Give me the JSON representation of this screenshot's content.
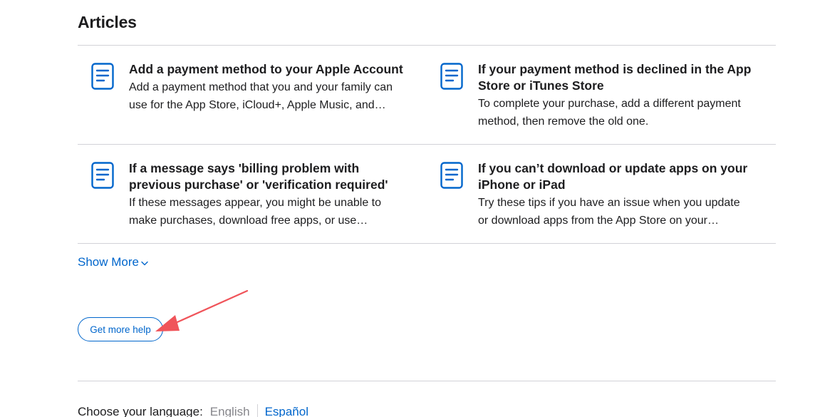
{
  "articles_section": {
    "title": "Articles",
    "items": [
      {
        "icon": "document-icon",
        "title": "Add a payment method to your Apple Account",
        "desc_line1": "Add a payment method that you and your family can",
        "desc_line2": "use for the App Store, iCloud+, Apple Music, and…"
      },
      {
        "icon": "document-icon",
        "title_line1": "If your payment method is declined in the App",
        "title_line2": "Store or iTunes Store",
        "desc_line1": "To complete your purchase, add a different payment",
        "desc_line2": "method, then remove the old one."
      },
      {
        "icon": "document-icon",
        "title_line1": "If a message says 'billing problem with",
        "title_line2": "previous purchase' or 'verification required'",
        "desc_line1": "If these messages appear, you might be unable to",
        "desc_line2": "make purchases, download free apps, or use…"
      },
      {
        "icon": "document-icon",
        "title_line1": "If you can’t download or update apps on your",
        "title_line2": "iPhone or iPad",
        "desc_line1": "Try these tips if you have an issue when you update",
        "desc_line2": "or download apps from the App Store on your…"
      }
    ],
    "show_more_label": "Show More"
  },
  "help": {
    "button_label": "Get more help"
  },
  "language": {
    "label": "Choose your language:",
    "current": "English",
    "alternate": "Español"
  },
  "colors": {
    "link": "#0066cc",
    "annotation_arrow": "#f0545a",
    "divider": "#d2d2d7"
  }
}
